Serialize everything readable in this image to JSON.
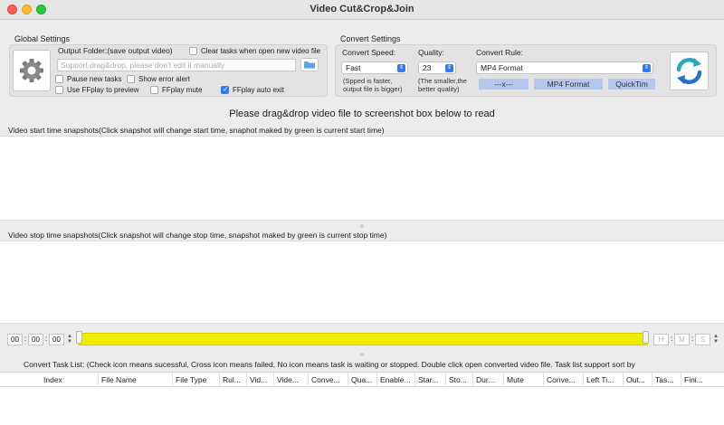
{
  "window": {
    "title": "Video Cut&Crop&Join"
  },
  "global_settings": {
    "label": "Global Settings",
    "output_folder_label": "Output Folder:(save output video)",
    "output_folder_placeholder": "Support drag&drop, please don't edit it manually",
    "clear_tasks_label": "Clear tasks when open new video file",
    "pause_new_tasks_label": "Pause new tasks",
    "show_error_alert_label": "Show error alert",
    "use_ffplay_label": "Use FFplay to preview",
    "ffplay_mute_label": "FFplay mute",
    "ffplay_auto_exit_label": "FFplay auto exit",
    "checks": {
      "clear_tasks": false,
      "pause_new_tasks": false,
      "show_error_alert": false,
      "use_ffplay": false,
      "ffplay_mute": false,
      "ffplay_auto_exit": true
    }
  },
  "convert_settings": {
    "label": "Convert Settings",
    "speed_label": "Convert Speed:",
    "speed_value": "Fast",
    "speed_hint_1": "(Spped is faster,",
    "speed_hint_2": "output file is bigger)",
    "quality_label": "Quality:",
    "quality_value": "23",
    "quality_hint_1": "(The smaller,the",
    "quality_hint_2": "better quality)",
    "rule_label": "Convert Rule:",
    "rule_value": "MP4 Format",
    "rule_chips": [
      "---x---",
      "MP4 Format",
      "QuickTim"
    ]
  },
  "main": {
    "drop_heading": "Please drag&drop video file to screenshot box below to read",
    "start_label": "Video start time snapshots(Click snapshot will change start time, snaphot maked by green is current start time)",
    "stop_label": "Video stop time snapshots(Click snapshot will change stop time, snapshot maked by green is current stop time)"
  },
  "time": {
    "start_h": "00",
    "start_m": "00",
    "start_s": "00",
    "end_h": "H",
    "end_m": "M",
    "end_s": "S",
    "separator": ":"
  },
  "tasks": {
    "label": "Convert Task List: (Check icon means sucessful,  Cross icon means failed, No icon means task is waiting or stopped. Double click open converted video file. Task list support sort by",
    "columns": [
      "Index",
      "File Name",
      "File Type",
      "Rul...",
      "Vid...",
      "Vide...",
      "Conve...",
      "Qua...",
      "Enable...",
      "Star...",
      "Sto...",
      "Dur...",
      "Mute",
      "Conve...",
      "Left Ti...",
      "Out...",
      "Tas...",
      "Fini..."
    ]
  },
  "colors": {
    "accent": "#2f7cf6",
    "slider": "#f0ec00",
    "chip": "#b5c7ee",
    "convert_icon": "#2aa7b8"
  }
}
